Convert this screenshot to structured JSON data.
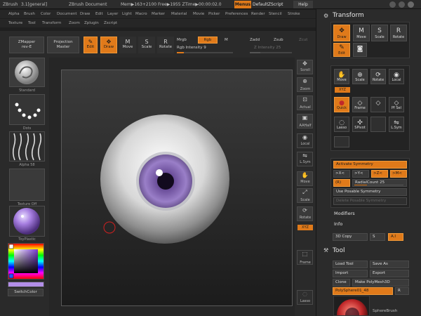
{
  "window": {
    "app": "ZBrush",
    "version": "3.1[general]",
    "document": "ZBrush Document",
    "mem": "Mem▶163+2100 Free▶1955 ZTime▶00:00:02.0",
    "menus_label": "Menus",
    "script_label": "DefaultZScript",
    "help_label": "Help"
  },
  "menus": {
    "row1": [
      "Alpha",
      "Brush",
      "Color",
      "Document",
      "Draw",
      "Edit",
      "Layer",
      "Light",
      "Macro",
      "Marker",
      "Material",
      "Movie",
      "Picker",
      "Preferences",
      "Render",
      "Stencil",
      "Stroke"
    ],
    "row2": [
      "Texture",
      "Tool",
      "Transform",
      "Zoom",
      "Zplugin",
      "Zscript"
    ]
  },
  "shelf": {
    "zmapper": "ZMapper",
    "zmapper_sub": "rev-E",
    "projection": "Projection",
    "projection_sub": "Master",
    "edit": "Edit",
    "draw": "Draw",
    "move": "Move",
    "scale": "Scale",
    "rotate": "Rotate",
    "mrgb": "Mrgb",
    "rgb": "Rgb",
    "m": "M",
    "rgb_intensity": "Rgb Intensity 9",
    "zadd": "Zadd",
    "zsub": "Zsub",
    "zcut": "Zcut",
    "z_intensity": "Z Intensity 25"
  },
  "left": {
    "standard": "Standard",
    "dots": "Dots",
    "alpha": "Alpha 58",
    "texture": "Texture Off",
    "material": "ToyPlastic",
    "switchcolor": "SwitchColor"
  },
  "righttools": {
    "scroll": "Scroll",
    "zoom": "Zoom",
    "actual": "Actual",
    "aahalf": "AAHalf",
    "local": "Local",
    "lsym": "L.Sym",
    "move": "Move",
    "scale": "Scale",
    "rotate": "Rotate",
    "xyz": "XYZ",
    "frame": "Frame",
    "lasso": "Lasso"
  },
  "panel": {
    "transform_title": "Transform",
    "draw": "Draw",
    "move": "Move",
    "scale": "Scale",
    "rotate": "Rotate",
    "edit": "Edit",
    "quick": "Quick",
    "frame": "Frame",
    "xyz": "XYZ",
    "pfsel": "Pf Sel",
    "lasso": "Lasso",
    "spivot": "SPivot",
    "lsym": "L.Sym",
    "local": "Local",
    "activate_symmetry": "Activate Symmetry",
    "sym_x": ">X<",
    "sym_y": ">Y<",
    "sym_z": ">Z<",
    "sym_m": ">M<",
    "r": "(R)",
    "radial_count": "RadialCount 25",
    "use_posable": "Use Posable Symmetry",
    "delete_posable": "Delete Posable Symmetry",
    "modifiers": "Modifiers",
    "info": "Info",
    "copy3d": "3D Copy",
    "s": "S",
    "ai": "A.I",
    "tool_title": "Tool",
    "load_tool": "Load Tool",
    "save_as": "Save As",
    "import": "Import",
    "export": "Export",
    "clone": "Clone",
    "make_polymesh": "Make PolyMesh3D",
    "polysphere": "PolySphere01_48",
    "r2": "R",
    "spherebrush": "SphereBrush"
  },
  "colors": {
    "accent": "#e07a1a",
    "iris": "#6b4e9a",
    "bg": "#1f1f1f"
  }
}
